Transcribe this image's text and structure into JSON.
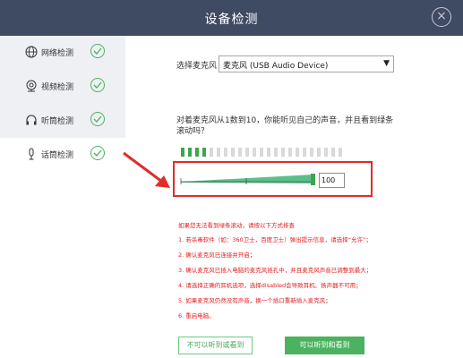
{
  "window": {
    "title": "设备检测",
    "close_icon": "×"
  },
  "sidebar": {
    "items": [
      {
        "label": "网络检测",
        "icon": "globe-icon",
        "checked": true
      },
      {
        "label": "视频检测",
        "icon": "webcam-icon",
        "checked": true
      },
      {
        "label": "听筒检测",
        "icon": "headphones-icon",
        "checked": true
      },
      {
        "label": "话筒检测",
        "icon": "microphone-icon",
        "checked": true,
        "active": true
      }
    ]
  },
  "main": {
    "mic_select_label": "选择麦克风",
    "mic_select_value": "麦克风 (USB Audio Device)",
    "instruction": "对着麦克风从1数到10，你能听见自己的声音，并且看到绿条滚动吗？",
    "level_meter": {
      "total_segments": 23,
      "active_segments": 4,
      "active_color": "#3aa64f",
      "inactive_color": "#d9d9d9"
    },
    "volume": {
      "value": "100",
      "level": 1.0
    },
    "help_title": "如果您无法看到绿条滚动，请按以下方式排查",
    "help_steps": [
      "1. 若杀毒软件（如：360卫士，百度卫士）弹出提示信息，请选择“允许”；",
      "2. 确认麦克风已连接并开启；",
      "3. 确认麦克风已插入电脑的麦克风插孔中，并且麦克风声音已调整到最大；",
      "4. 请选择正确的耳机选项，选择disabled会导致耳机、扬声器不可用；",
      "5. 如果麦克风仍然没有声音，换一个插口重新插入麦克风；",
      "6. 重启电脑。"
    ],
    "buttons": {
      "cannot": "不可以听到或看到",
      "can": "可以听到和看到"
    }
  },
  "colors": {
    "titlebar": "#3f4a63",
    "accent_green": "#4bb35f",
    "alert_red": "#e02020"
  }
}
